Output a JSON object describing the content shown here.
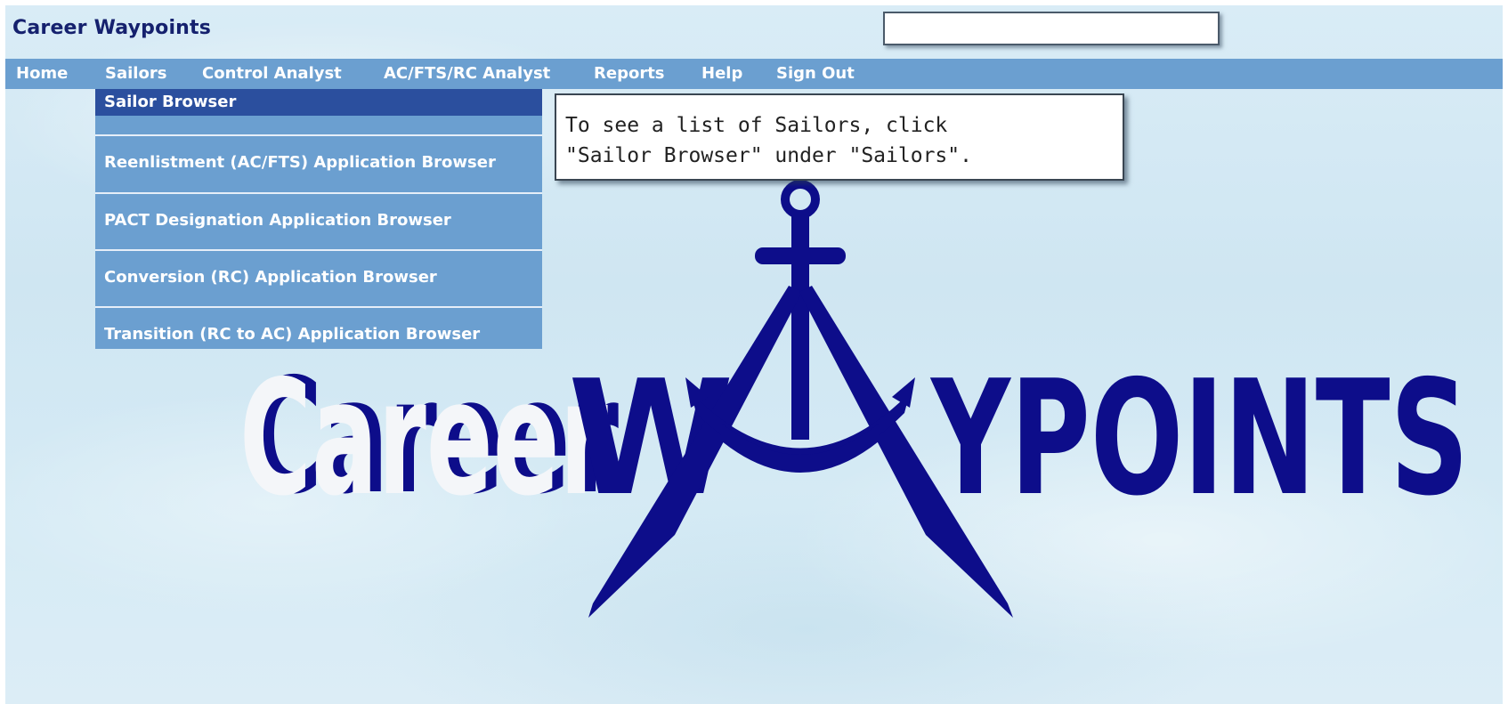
{
  "app": {
    "title": "Career Waypoints"
  },
  "search": {
    "value": "",
    "placeholder": ""
  },
  "menubar": {
    "items": [
      {
        "label": "Home"
      },
      {
        "label": "Sailors"
      },
      {
        "label": "Control Analyst"
      },
      {
        "label": "AC/FTS/RC Analyst"
      },
      {
        "label": "Reports"
      },
      {
        "label": "Help"
      },
      {
        "label": "Sign Out"
      }
    ]
  },
  "dropdown": {
    "parent": "Sailors",
    "items": [
      {
        "label": "Sailor Browser",
        "active": true
      },
      {
        "label": "Reenlistment (AC/FTS) Application Browser"
      },
      {
        "label": "PACT Designation Application Browser"
      },
      {
        "label": "Conversion (RC) Application Browser"
      },
      {
        "label": "Transition (RC to AC) Application Browser"
      }
    ]
  },
  "tooltip": {
    "line1": "To see a list of Sailors, click",
    "line2": "\"Sailor Browser\" under \"Sailors\"."
  },
  "logo": {
    "word1": "Career",
    "word2_left": "W",
    "word2_right": "YPOINTS",
    "icon": "anchor-compass-icon",
    "color": "#0d0d8a"
  },
  "colors": {
    "menubar": "#6b9fd0",
    "active_item": "#2b4f9e",
    "title": "#15216e"
  }
}
